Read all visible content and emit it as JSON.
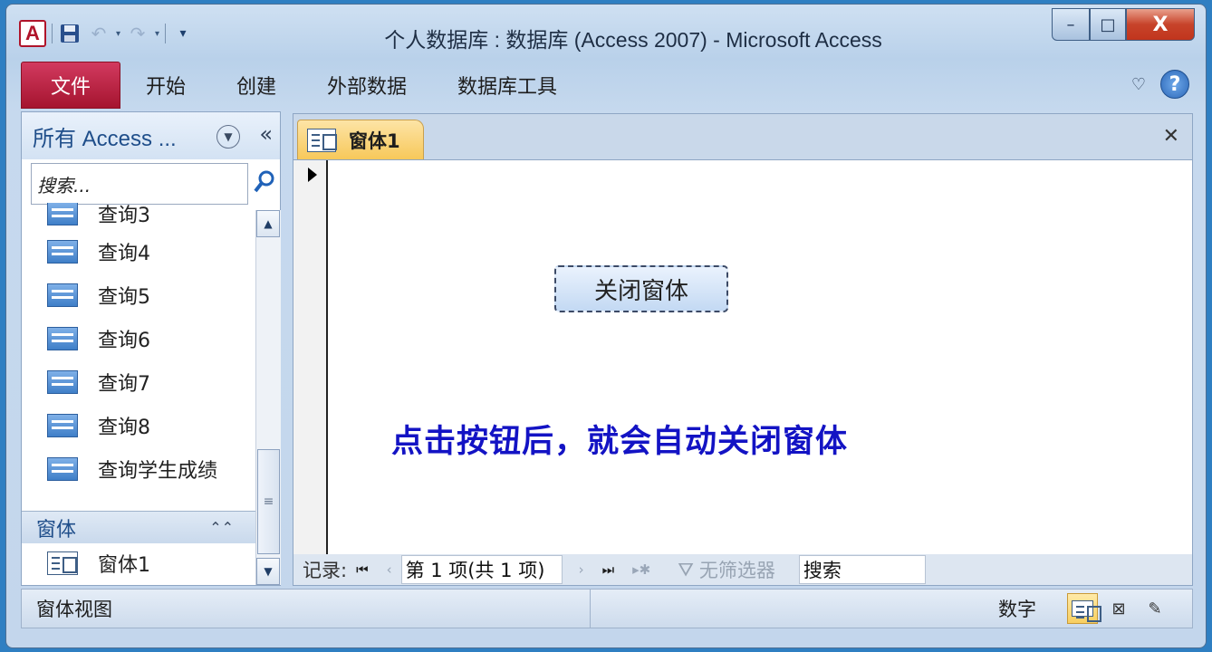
{
  "window": {
    "title": "个人数据库 : 数据库 (Access 2007)  -  Microsoft Access",
    "app_icon_letter": "A",
    "controls": {
      "minimize": "–",
      "maximize": "□",
      "close": "X"
    }
  },
  "quick_access": {
    "save_icon": "save-icon",
    "undo_icon": "undo-icon",
    "redo_icon": "redo-icon",
    "customize_icon": "customize-icon"
  },
  "ribbon": {
    "file_tab": "文件",
    "tabs": [
      "开始",
      "创建",
      "外部数据",
      "数据库工具"
    ]
  },
  "nav_pane": {
    "title": "所有 Access ...",
    "search_placeholder": "搜索...",
    "queries": [
      "查询3",
      "查询4",
      "查询5",
      "查询6",
      "查询7",
      "查询8",
      "查询学生成绩"
    ],
    "group_forms": "窗体",
    "forms": [
      "窗体1"
    ]
  },
  "document": {
    "tab_label": "窗体1",
    "button_label": "关闭窗体",
    "note_label": "点击按钮后，就会自动关闭窗体"
  },
  "record_bar": {
    "label": "记录:",
    "position": "第 1 项(共 1 项)",
    "filter": "无筛选器",
    "search": "搜索"
  },
  "status_bar": {
    "view": "窗体视图",
    "num_lock": "数字"
  }
}
